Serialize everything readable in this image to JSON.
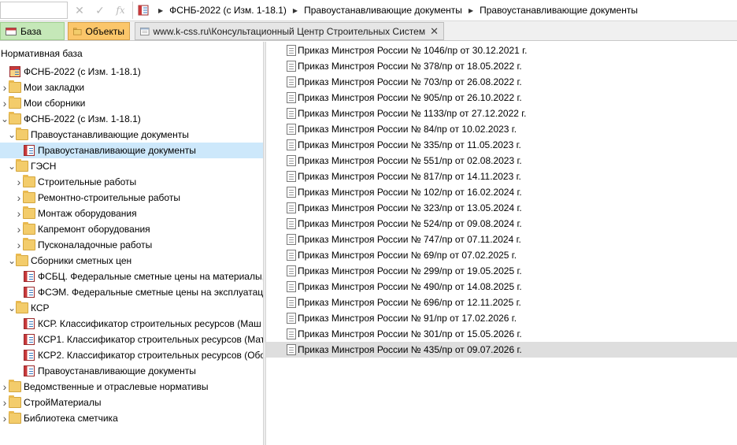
{
  "toolbar": {
    "cancel_glyph": "✕",
    "accept_glyph": "✓",
    "fx_glyph": "fx"
  },
  "breadcrumb": [
    "ФСНБ-2022 (с Изм. 1-18.1)",
    "Правоустанавливающие документы",
    "Правоустанавливающие документы"
  ],
  "tabs": {
    "base": "База",
    "objects": "Объекты",
    "web": "www.k-css.ru\\Консультационный Центр Строительных Систем",
    "close_glyph": "✕"
  },
  "tree": {
    "title": "Нормативная база",
    "items": [
      {
        "label": "ФСНБ-2022 (с Изм. 1-18.1)",
        "level": 0,
        "arrow": "",
        "icon": "database-icon"
      },
      {
        "label": "Мои закладки",
        "level": 0,
        "arrow": "›",
        "icon": "folder-icon"
      },
      {
        "label": "Мои сборники",
        "level": 0,
        "arrow": "›",
        "icon": "folder-icon"
      },
      {
        "label": "ФСНБ-2022 (с Изм. 1-18.1)",
        "level": 0,
        "arrow": "⌄",
        "icon": "folder-icon"
      },
      {
        "label": "Правоустанавливающие документы",
        "level": 1,
        "arrow": "⌄",
        "icon": "folder-icon"
      },
      {
        "label": "Правоустанавливающие документы",
        "level": 2,
        "arrow": "",
        "icon": "book-icon",
        "selected": true
      },
      {
        "label": "ГЭСН",
        "level": 1,
        "arrow": "⌄",
        "icon": "folder-icon"
      },
      {
        "label": "Строительные работы",
        "level": 2,
        "arrow": "›",
        "icon": "folder-icon"
      },
      {
        "label": "Ремонтно-строительные работы",
        "level": 2,
        "arrow": "›",
        "icon": "folder-icon"
      },
      {
        "label": "Монтаж оборудования",
        "level": 2,
        "arrow": "›",
        "icon": "folder-icon"
      },
      {
        "label": "Капремонт оборудования",
        "level": 2,
        "arrow": "›",
        "icon": "folder-icon"
      },
      {
        "label": "Пусконаладочные работы",
        "level": 2,
        "arrow": "›",
        "icon": "folder-icon"
      },
      {
        "label": "Сборники сметных цен",
        "level": 1,
        "arrow": "⌄",
        "icon": "folder-icon"
      },
      {
        "label": "ФСБЦ. Федеральные сметные цены на материалы,",
        "level": 2,
        "arrow": "",
        "icon": "book-icon"
      },
      {
        "label": "ФСЭМ. Федеральные сметные цены на эксплуатац",
        "level": 2,
        "arrow": "",
        "icon": "book-icon"
      },
      {
        "label": "КСР",
        "level": 1,
        "arrow": "⌄",
        "icon": "folder-icon"
      },
      {
        "label": "КСР. Классификатор строительных ресурсов (Маш",
        "level": 2,
        "arrow": "",
        "icon": "book-icon"
      },
      {
        "label": "КСР1. Классификатор строительных ресурсов (Мат",
        "level": 2,
        "arrow": "",
        "icon": "book-icon"
      },
      {
        "label": "КСР2. Классификатор строительных ресурсов (Обо",
        "level": 2,
        "arrow": "",
        "icon": "book-icon"
      },
      {
        "label": "Правоустанавливающие документы",
        "level": 2,
        "arrow": "",
        "icon": "book-icon"
      },
      {
        "label": "Ведомственные и отраслевые нормативы",
        "level": 0,
        "arrow": "›",
        "icon": "folder-icon"
      },
      {
        "label": "СтройМатериалы",
        "level": 0,
        "arrow": "›",
        "icon": "folder-icon"
      },
      {
        "label": "Библиотека сметчика",
        "level": 0,
        "arrow": "›",
        "icon": "folder-icon"
      }
    ]
  },
  "documents": [
    "Приказ Минстроя России № 1046/пр от 30.12.2021 г.",
    "Приказ Минстроя России № 378/пр от 18.05.2022 г.",
    "Приказ Минстроя России № 703/пр от 26.08.2022 г.",
    "Приказ Минстроя России № 905/пр от 26.10.2022 г.",
    "Приказ Минстроя России № 1133/пр от 27.12.2022 г.",
    "Приказ Минстроя России № 84/пр от 10.02.2023 г.",
    "Приказ Минстроя России № 335/пр от 11.05.2023 г.",
    "Приказ Минстроя России № 551/пр от 02.08.2023 г.",
    "Приказ Минстроя России № 817/пр от 14.11.2023 г.",
    "Приказ Минстроя России № 102/пр от 16.02.2024 г.",
    "Приказ Минстроя России № 323/пр от 13.05.2024 г.",
    "Приказ Минстроя России № 524/пр от 09.08.2024 г.",
    "Приказ Минстроя России № 747/пр от 07.11.2024 г.",
    "Приказ Минстроя России № 69/пр от 07.02.2025 г.",
    "Приказ Минстроя России № 299/пр от 19.05.2025 г.",
    "Приказ Минстроя России № 490/пр от 14.08.2025 г.",
    "Приказ Минстроя России № 696/пр от 12.11.2025 г.",
    "Приказ Минстроя России № 91/пр от 17.02.2026 г.",
    "Приказ Минстроя России № 301/пр от 15.05.2026 г.",
    "Приказ Минстроя России № 435/пр от 09.07.2026 г."
  ],
  "highlighted_document_index": 19
}
